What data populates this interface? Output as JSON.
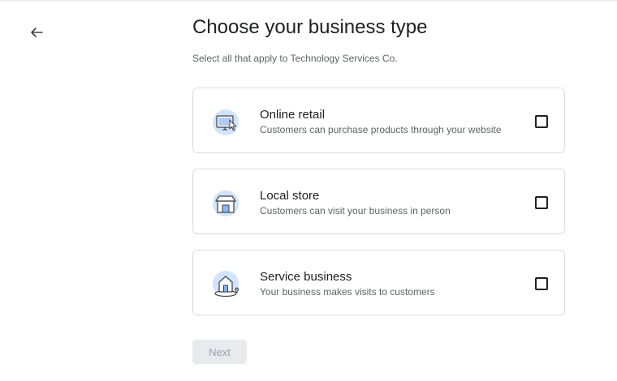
{
  "page": {
    "title": "Choose your business type",
    "subtitle": "Select all that apply to Technology Services Co."
  },
  "options": [
    {
      "title": "Online retail",
      "description": "Customers can purchase products through your website",
      "icon": "monitor-cursor-icon",
      "checked": false
    },
    {
      "title": "Local store",
      "description": "Customers can visit your business in person",
      "icon": "storefront-icon",
      "checked": false
    },
    {
      "title": "Service business",
      "description": "Your business makes visits to customers",
      "icon": "house-location-icon",
      "checked": false
    }
  ],
  "actions": {
    "next_label": "Next",
    "next_disabled": true
  },
  "colors": {
    "icon_bg": "#d2e3fc",
    "border": "#dadce0",
    "disabled_button_bg": "#e8eaed"
  }
}
